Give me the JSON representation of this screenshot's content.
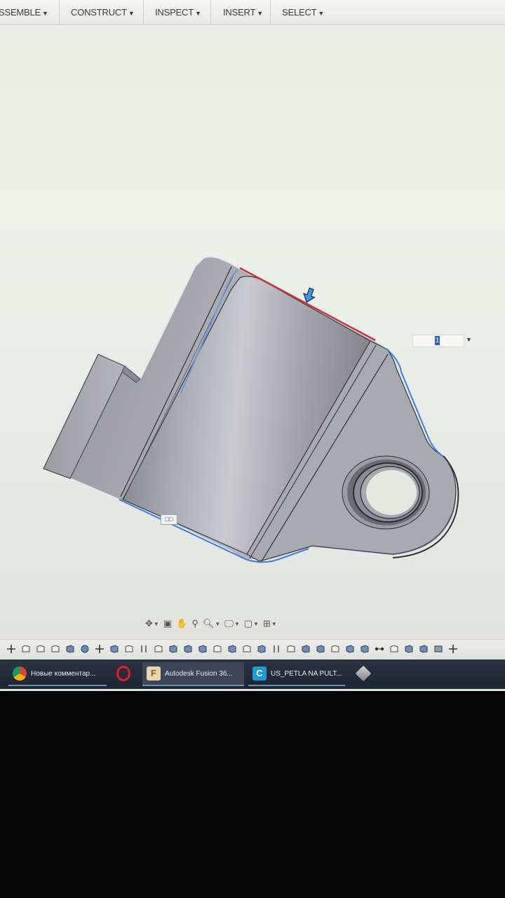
{
  "menubar": {
    "items": [
      {
        "label": "SSEMBLE"
      },
      {
        "label": "CONSTRUCT"
      },
      {
        "label": "INSPECT"
      },
      {
        "label": "INSERT"
      },
      {
        "label": "SELECT"
      }
    ]
  },
  "dimension_input": {
    "value": "1"
  },
  "model_label": {
    "text": "□□"
  },
  "navigation": {
    "tools": [
      "orbit",
      "look-at",
      "pan",
      "zoom-window",
      "zoom",
      "display-settings",
      "visual-style",
      "grid"
    ]
  },
  "taskbar": {
    "tasks": [
      {
        "label": "Новые комментар...",
        "icon": "chrome-icon"
      },
      {
        "label": "",
        "icon": "opera-icon"
      },
      {
        "label": "Autodesk Fusion 36...",
        "icon": "fusion-icon"
      },
      {
        "label": "US_PETLA NA PULT...",
        "icon": "app-c-icon"
      },
      {
        "label": "",
        "icon": "cube-app-icon"
      }
    ]
  },
  "colors": {
    "accent": "#2f5fb8",
    "selected_edge": "#c8323c",
    "highlight": "#3d7fd8",
    "part": "#a6a7ad"
  }
}
